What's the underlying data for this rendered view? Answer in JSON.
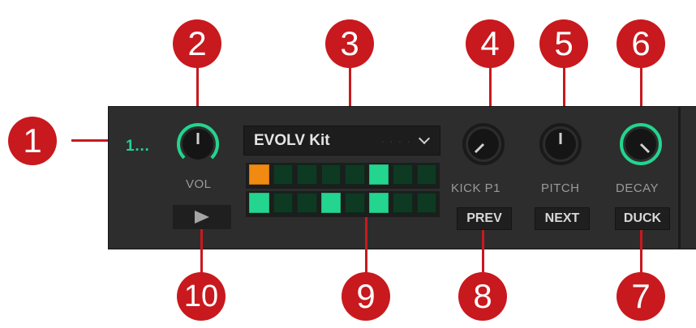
{
  "callouts": [
    "1",
    "2",
    "3",
    "4",
    "5",
    "6",
    "7",
    "8",
    "9",
    "10"
  ],
  "deck": {
    "slot_label": "1…",
    "volume": {
      "label": "VOL",
      "level": 0.5
    },
    "kit_select": {
      "value": "EVOLV Kit",
      "icon": "chevron-down-icon"
    },
    "knobs": {
      "kick": {
        "label": "KICK P1",
        "level": 0.15
      },
      "pitch": {
        "label": "PITCH",
        "level": 0.5
      },
      "decay": {
        "label": "DECAY",
        "level": 0.85
      }
    },
    "buttons": {
      "prev": "PREV",
      "next": "NEXT",
      "duck": "DUCK",
      "play_icon": "play-icon"
    },
    "pattern": {
      "row1": [
        "current",
        "off",
        "off",
        "off",
        "off",
        "on",
        "off",
        "off"
      ],
      "row2": [
        "on",
        "off",
        "off",
        "on",
        "off",
        "on",
        "off",
        "off"
      ]
    }
  },
  "colors": {
    "accent": "#23d58f",
    "current_step": "#f08a12",
    "callout": "#c8191e",
    "panel": "#2d2d2d"
  }
}
